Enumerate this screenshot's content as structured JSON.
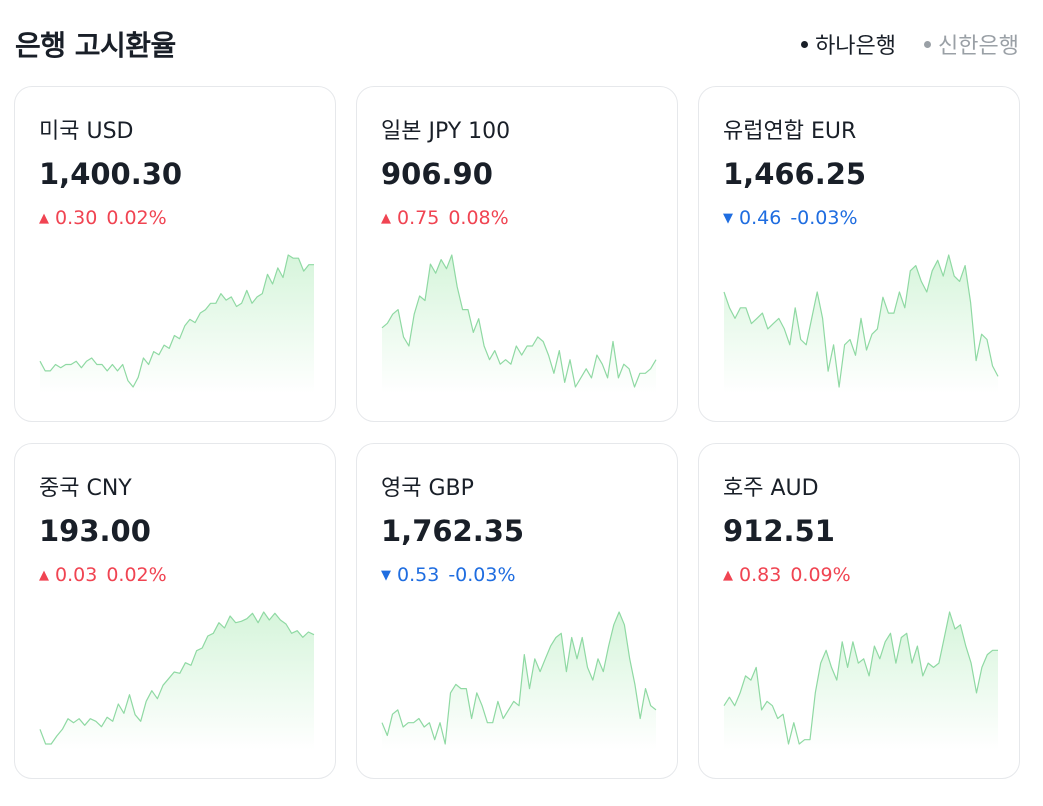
{
  "header": {
    "title": "은행 고시환율",
    "banks": [
      {
        "label": "하나은행",
        "active": true
      },
      {
        "label": "신한은행",
        "active": false
      }
    ]
  },
  "colors": {
    "up": "#f04452",
    "down": "#1f6de0",
    "spark_line": "#8fd9a3",
    "spark_fill": "#d6f5db"
  },
  "currencies": [
    {
      "name": "미국 USD",
      "rate": "1,400.30",
      "direction": "up",
      "arrow": "▲",
      "change": "0.30",
      "percent": "0.02%",
      "trend": [
        1400.4,
        1400.1,
        1400.1,
        1400.3,
        1400.2,
        1400.3,
        1400.3,
        1400.4,
        1400.2,
        1400.4,
        1400.5,
        1400.3,
        1400.3,
        1400.1,
        1400.3,
        1400.1,
        1400.3,
        1399.8,
        1399.6,
        1399.9,
        1400.5,
        1400.3,
        1400.7,
        1400.6,
        1400.9,
        1400.8,
        1401.2,
        1401.1,
        1401.5,
        1401.7,
        1401.6,
        1401.9,
        1402.0,
        1402.2,
        1402.2,
        1402.5,
        1402.3,
        1402.4,
        1402.1,
        1402.2,
        1402.6,
        1402.2,
        1402.4,
        1402.5,
        1403.1,
        1402.8,
        1403.3,
        1403.0,
        1403.7,
        1403.6,
        1403.6,
        1403.2,
        1403.4,
        1403.4
      ]
    },
    {
      "name": "일본 JPY 100",
      "rate": "906.90",
      "direction": "up",
      "arrow": "▲",
      "change": "0.75",
      "percent": "0.08%",
      "trend": [
        906.3,
        906.4,
        906.6,
        906.7,
        906.1,
        905.9,
        906.6,
        907.0,
        906.9,
        907.7,
        907.5,
        907.8,
        907.6,
        907.9,
        907.2,
        906.7,
        906.7,
        906.2,
        906.5,
        905.9,
        905.6,
        905.8,
        905.5,
        905.6,
        905.5,
        905.9,
        905.7,
        905.9,
        905.9,
        906.1,
        906.0,
        905.7,
        905.3,
        905.8,
        905.1,
        905.6,
        905.0,
        905.2,
        905.4,
        905.2,
        905.7,
        905.5,
        905.2,
        906.0,
        905.2,
        905.5,
        905.4,
        905.0,
        905.3,
        905.3,
        905.4,
        905.6
      ]
    },
    {
      "name": "유럽연합 EUR",
      "rate": "1,466.25",
      "direction": "down",
      "arrow": "▼",
      "change": "0.46",
      "percent": "-0.03%",
      "trend": [
        1466.3,
        1466.0,
        1465.8,
        1466.0,
        1466.0,
        1465.7,
        1465.8,
        1465.9,
        1465.6,
        1465.7,
        1465.8,
        1465.6,
        1465.3,
        1466.0,
        1465.4,
        1465.3,
        1465.8,
        1466.3,
        1465.8,
        1464.8,
        1465.3,
        1464.5,
        1465.3,
        1465.4,
        1465.1,
        1465.8,
        1465.2,
        1465.5,
        1465.6,
        1466.2,
        1465.9,
        1465.9,
        1466.3,
        1466.0,
        1466.7,
        1466.8,
        1466.5,
        1466.3,
        1466.7,
        1466.9,
        1466.6,
        1467.0,
        1466.6,
        1466.5,
        1466.8,
        1466.1,
        1465.0,
        1465.5,
        1465.4,
        1464.9,
        1464.7
      ]
    },
    {
      "name": "중국 CNY",
      "rate": "193.00",
      "direction": "up",
      "arrow": "▲",
      "change": "0.03",
      "percent": "0.02%",
      "trend": [
        192.83,
        192.72,
        192.72,
        192.78,
        192.83,
        192.91,
        192.88,
        192.91,
        192.86,
        192.91,
        192.89,
        192.85,
        192.92,
        192.89,
        193.02,
        192.95,
        193.09,
        192.94,
        192.89,
        193.04,
        193.12,
        193.06,
        193.16,
        193.21,
        193.26,
        193.25,
        193.33,
        193.31,
        193.42,
        193.44,
        193.53,
        193.55,
        193.63,
        193.59,
        193.68,
        193.63,
        193.64,
        193.66,
        193.7,
        193.63,
        193.71,
        193.65,
        193.7,
        193.65,
        193.62,
        193.55,
        193.57,
        193.52,
        193.56,
        193.54
      ]
    },
    {
      "name": "영국 GBP",
      "rate": "1,762.35",
      "direction": "down",
      "arrow": "▼",
      "change": "0.53",
      "percent": "-0.03%",
      "trend": [
        1762.1,
        1761.8,
        1762.3,
        1762.4,
        1762.0,
        1762.1,
        1762.1,
        1762.2,
        1762.0,
        1762.1,
        1761.7,
        1762.1,
        1761.6,
        1762.8,
        1763.0,
        1762.9,
        1762.9,
        1762.2,
        1762.8,
        1762.5,
        1762.1,
        1762.1,
        1762.6,
        1762.2,
        1762.4,
        1762.6,
        1762.5,
        1763.7,
        1762.9,
        1763.6,
        1763.3,
        1763.6,
        1763.9,
        1764.1,
        1764.2,
        1763.3,
        1764.1,
        1763.6,
        1764.1,
        1763.4,
        1763.1,
        1763.6,
        1763.3,
        1763.9,
        1764.4,
        1764.7,
        1764.4,
        1763.6,
        1763.0,
        1762.2,
        1762.9,
        1762.5,
        1762.4
      ]
    },
    {
      "name": "호주 AUD",
      "rate": "912.51",
      "direction": "up",
      "arrow": "▲",
      "change": "0.83",
      "percent": "0.09%",
      "trend": [
        911.9,
        912.1,
        911.9,
        912.2,
        912.6,
        912.5,
        912.8,
        911.8,
        912.0,
        911.9,
        911.6,
        911.7,
        911.0,
        911.5,
        911.0,
        911.1,
        911.1,
        912.2,
        912.9,
        913.2,
        912.8,
        912.5,
        913.4,
        912.8,
        913.4,
        912.9,
        913.0,
        912.6,
        913.3,
        913.0,
        913.4,
        913.6,
        912.9,
        913.5,
        913.6,
        912.9,
        913.3,
        912.6,
        912.9,
        912.8,
        912.9,
        913.5,
        914.1,
        913.7,
        913.8,
        913.3,
        912.9,
        912.2,
        912.8,
        913.1,
        913.2,
        913.2
      ]
    }
  ]
}
